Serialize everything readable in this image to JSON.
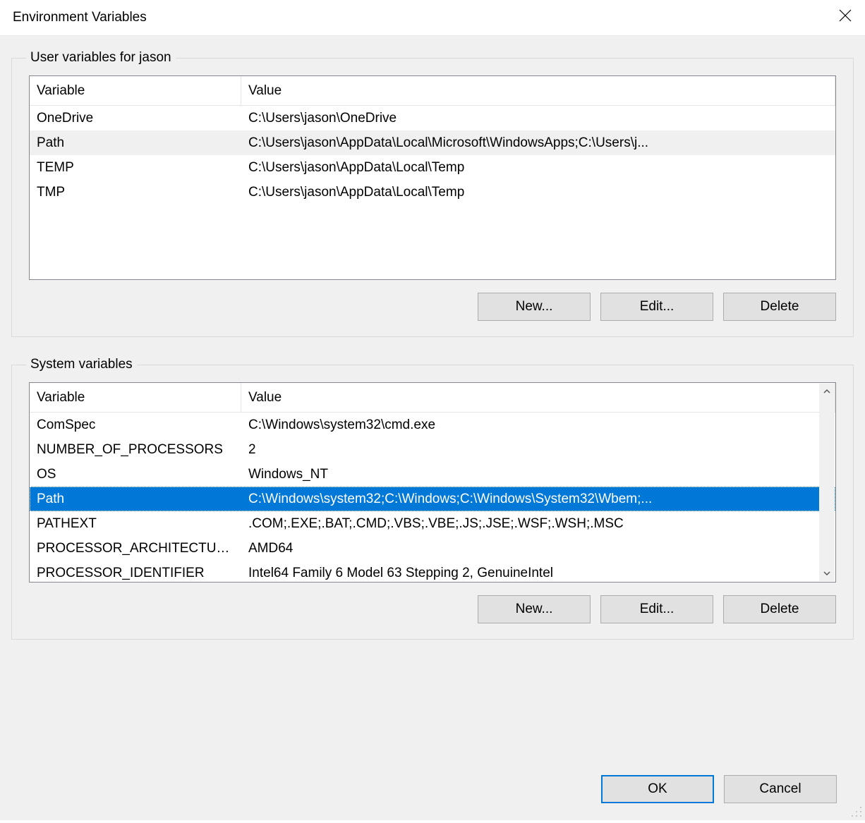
{
  "title": "Environment Variables",
  "close_icon": "close-icon",
  "columns": {
    "variable": "Variable",
    "value": "Value"
  },
  "user_group": {
    "legend": "User variables for jason",
    "rows": [
      {
        "name": "OneDrive",
        "value": "C:\\Users\\jason\\OneDrive",
        "selected": false
      },
      {
        "name": "Path",
        "value": "C:\\Users\\jason\\AppData\\Local\\Microsoft\\WindowsApps;C:\\Users\\j...",
        "selected": "inactive"
      },
      {
        "name": "TEMP",
        "value": "C:\\Users\\jason\\AppData\\Local\\Temp",
        "selected": false
      },
      {
        "name": "TMP",
        "value": "C:\\Users\\jason\\AppData\\Local\\Temp",
        "selected": false
      }
    ],
    "buttons": {
      "new": "New...",
      "edit": "Edit...",
      "delete": "Delete"
    }
  },
  "system_group": {
    "legend": "System variables",
    "rows": [
      {
        "name": "ComSpec",
        "value": "C:\\Windows\\system32\\cmd.exe",
        "selected": false
      },
      {
        "name": "NUMBER_OF_PROCESSORS",
        "value": "2",
        "selected": false
      },
      {
        "name": "OS",
        "value": "Windows_NT",
        "selected": false
      },
      {
        "name": "Path",
        "value": "C:\\Windows\\system32;C:\\Windows;C:\\Windows\\System32\\Wbem;...",
        "selected": "active"
      },
      {
        "name": "PATHEXT",
        "value": ".COM;.EXE;.BAT;.CMD;.VBS;.VBE;.JS;.JSE;.WSF;.WSH;.MSC",
        "selected": false
      },
      {
        "name": "PROCESSOR_ARCHITECTURE",
        "value": "AMD64",
        "selected": false
      },
      {
        "name": "PROCESSOR_IDENTIFIER",
        "value": "Intel64 Family 6 Model 63 Stepping 2, GenuineIntel",
        "selected": false
      }
    ],
    "buttons": {
      "new": "New...",
      "edit": "Edit...",
      "delete": "Delete"
    }
  },
  "dialog_buttons": {
    "ok": "OK",
    "cancel": "Cancel"
  }
}
